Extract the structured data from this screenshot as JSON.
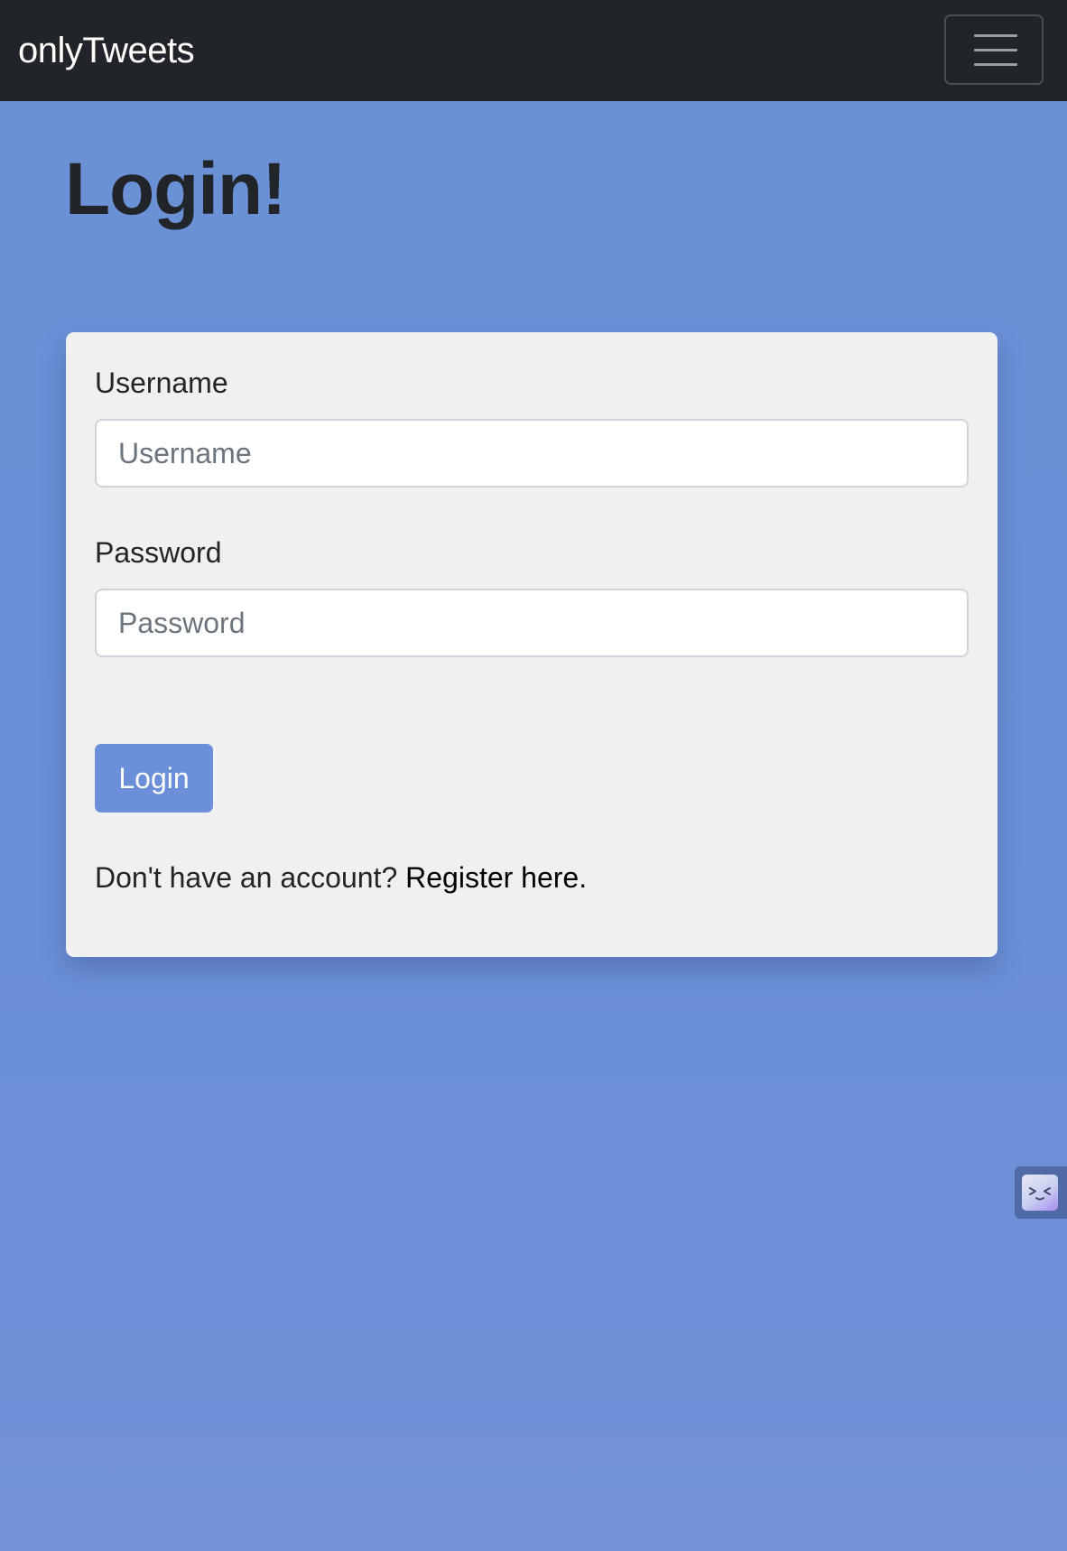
{
  "navbar": {
    "brand": "onlyTweets",
    "menu_icon": "hamburger-menu-icon"
  },
  "page": {
    "title": "Login!"
  },
  "form": {
    "username_label": "Username",
    "username_placeholder": "Username",
    "username_value": "",
    "password_label": "Password",
    "password_placeholder": "Password",
    "password_value": "",
    "submit_label": "Login",
    "register_prompt": "Don't have an account?",
    "register_link": "Register here."
  },
  "extension_widget": {
    "icon": "extension-face-icon"
  },
  "colors": {
    "navbar_bg": "#212529",
    "page_bg": "#6b8fd7",
    "card_bg": "#f0f0f0",
    "button_bg": "#6b8fd8",
    "text_dark": "#212529"
  }
}
